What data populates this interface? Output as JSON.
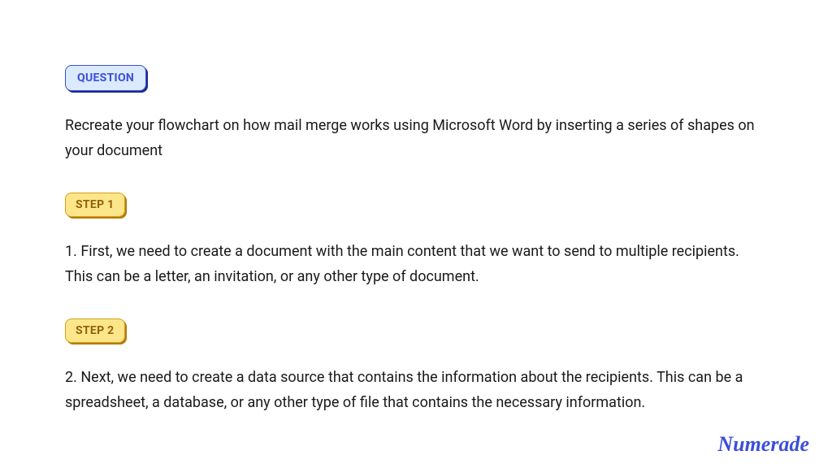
{
  "question": {
    "badge_label": "QUESTION",
    "text": "Recreate your flowchart on how mail merge works using Microsoft Word by inserting a series of shapes on your document"
  },
  "steps": [
    {
      "badge_label": "STEP 1",
      "text": "1. First, we need to create a document with the main content that we want to send to multiple recipients. This can be a letter, an invitation, or any other type of document."
    },
    {
      "badge_label": "STEP 2",
      "text": "2. Next, we need to create a data source that contains the information about the recipients. This can be a spreadsheet, a database, or any other type of file that contains the necessary information."
    }
  ],
  "brand": {
    "logo_text": "Numerade"
  }
}
